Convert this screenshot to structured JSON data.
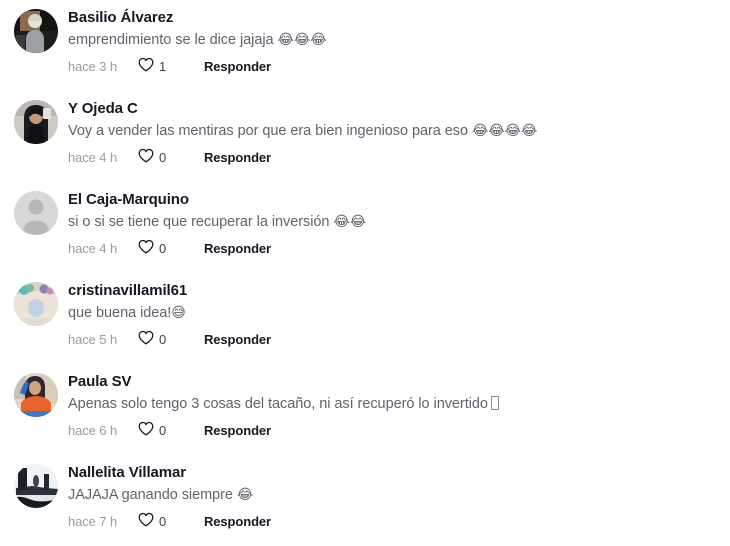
{
  "colors": {
    "background": "#ffffff",
    "username": "#161823",
    "comment_text": "#60636e",
    "timestamp": "#9a9ca4",
    "reply": "#161823",
    "heart": "#161823"
  },
  "comments": [
    {
      "username": "Basilio Álvarez",
      "text": "emprendimiento se le dice jajaja ",
      "emojis": "😂😂😂",
      "trailing_tofu": false,
      "timestamp": "hace 3 h",
      "like_count": "1",
      "reply_label": "Responder",
      "avatar_name": "avatar-basilio-alvarez"
    },
    {
      "username": "Y Ojeda C",
      "text": "Voy a vender las mentiras por que era bien ingenioso para eso ",
      "emojis": "😂😂😂😂",
      "trailing_tofu": false,
      "timestamp": "hace 4 h",
      "like_count": "0",
      "reply_label": "Responder",
      "avatar_name": "avatar-y-ojeda-c"
    },
    {
      "username": "El Caja-Marquino",
      "text": "si o si se tiene que recuperar la inversión ",
      "emojis": "😂😂",
      "trailing_tofu": false,
      "timestamp": "hace 4 h",
      "like_count": "0",
      "reply_label": "Responder",
      "avatar_name": "avatar-el-caja-marquino"
    },
    {
      "username": "cristinavillamil61",
      "text": "que buena idea!",
      "emojis": "😅",
      "trailing_tofu": false,
      "timestamp": "hace 5 h",
      "like_count": "0",
      "reply_label": "Responder",
      "avatar_name": "avatar-cristinavillamil61"
    },
    {
      "username": "Paula SV",
      "text": "Apenas solo tengo 3 cosas del tacaño, ni así recuperó lo invertido",
      "emojis": "",
      "trailing_tofu": true,
      "timestamp": "hace 6 h",
      "like_count": "0",
      "reply_label": "Responder",
      "avatar_name": "avatar-paula-sv"
    },
    {
      "username": "Nallelita Villamar",
      "text": "JAJAJA ganando siempre ",
      "emojis": "😂",
      "trailing_tofu": false,
      "timestamp": "hace 7 h",
      "like_count": "0",
      "reply_label": "Responder",
      "avatar_name": "avatar-nallelita-villamar"
    }
  ]
}
